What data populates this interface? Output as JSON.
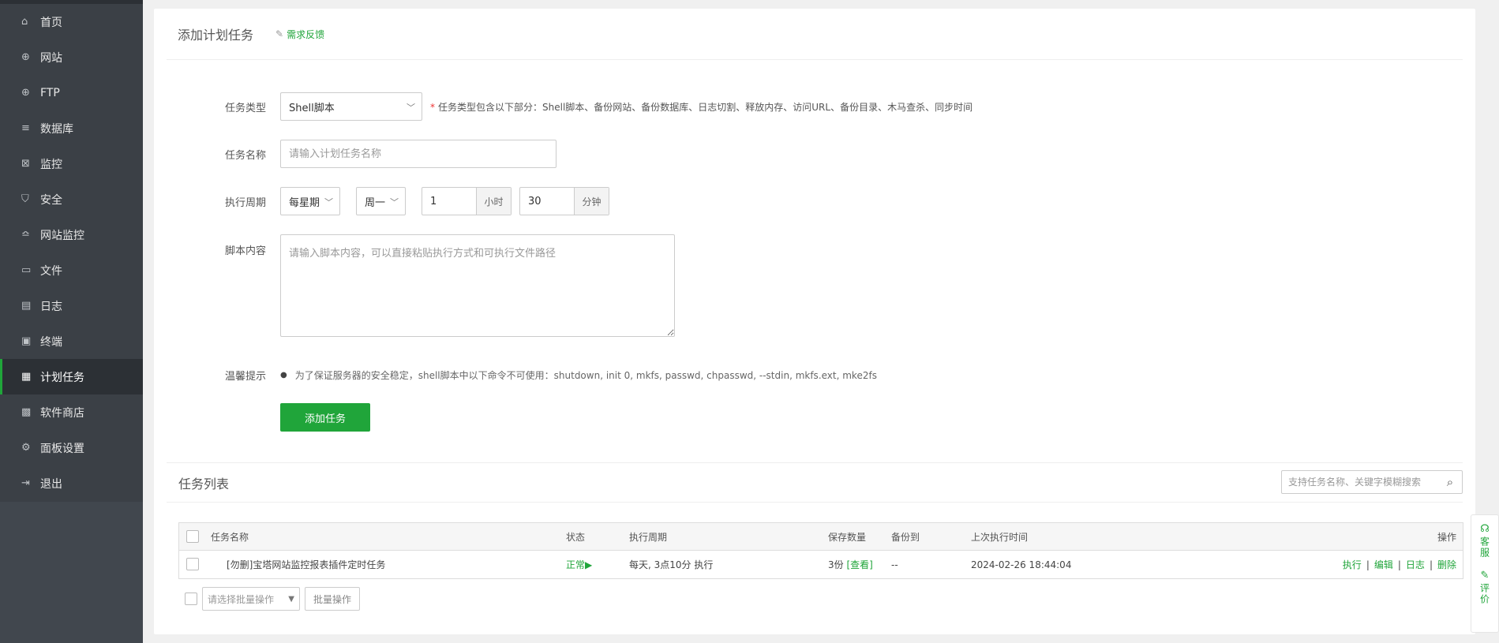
{
  "sidebar": {
    "items": [
      {
        "label": "首页",
        "icon": "home-icon",
        "glyph": "⌂"
      },
      {
        "label": "网站",
        "icon": "globe-icon",
        "glyph": "⊕"
      },
      {
        "label": "FTP",
        "icon": "ftp-icon",
        "glyph": "⊕"
      },
      {
        "label": "数据库",
        "icon": "database-icon",
        "glyph": "≡"
      },
      {
        "label": "监控",
        "icon": "monitor-icon",
        "glyph": "⊠"
      },
      {
        "label": "安全",
        "icon": "shield-icon",
        "glyph": "⛉"
      },
      {
        "label": "网站监控",
        "icon": "site-monitor-icon",
        "glyph": "≏"
      },
      {
        "label": "文件",
        "icon": "folder-icon",
        "glyph": "▭"
      },
      {
        "label": "日志",
        "icon": "log-icon",
        "glyph": "▤"
      },
      {
        "label": "终端",
        "icon": "terminal-icon",
        "glyph": "▣"
      },
      {
        "label": "计划任务",
        "icon": "calendar-icon",
        "glyph": "▦"
      },
      {
        "label": "软件商店",
        "icon": "apps-icon",
        "glyph": "▩"
      },
      {
        "label": "面板设置",
        "icon": "gear-icon",
        "glyph": "⚙"
      },
      {
        "label": "退出",
        "icon": "logout-icon",
        "glyph": "⇥"
      }
    ],
    "active_index": 10
  },
  "add_task": {
    "title": "添加计划任务",
    "feedback": "需求反馈",
    "type_label": "任务类型",
    "type_value": "Shell脚本",
    "type_hint": "任务类型包含以下部分：Shell脚本、备份网站、备份数据库、日志切割、释放内存、访问URL、备份目录、木马查杀、同步时间",
    "name_label": "任务名称",
    "name_placeholder": "请输入计划任务名称",
    "cycle_label": "执行周期",
    "cycle_value": "每星期",
    "weekday_value": "周一",
    "hour_value": "1",
    "hour_unit": "小时",
    "minute_value": "30",
    "minute_unit": "分钟",
    "script_label": "脚本内容",
    "script_placeholder": "请输入脚本内容，可以直接粘贴执行方式和可执行文件路径",
    "tip_label": "温馨提示",
    "tip_text": "为了保证服务器的安全稳定，shell脚本中以下命令不可使用：shutdown, init 0, mkfs, passwd, chpasswd, --stdin, mkfs.ext, mke2fs",
    "submit_label": "添加任务"
  },
  "task_list": {
    "title": "任务列表",
    "search_placeholder": "支持任务名称、关键字模糊搜索",
    "columns": [
      "任务名称",
      "状态",
      "执行周期",
      "保存数量",
      "备份到",
      "上次执行时间",
      "操作"
    ],
    "rows": [
      {
        "name": "[勿删]宝塔网站监控报表插件定时任务",
        "status": "正常▶",
        "cycle": "每天, 3点10分 执行",
        "save_count": "3份",
        "view": "[查看]",
        "backup_to": "--",
        "last_run": "2024-02-26 18:44:04",
        "ops": [
          "执行",
          "编辑",
          "日志",
          "删除"
        ]
      }
    ],
    "batch_placeholder": "请选择批量操作",
    "batch_button": "批量操作"
  },
  "float_widget": {
    "service": "客服",
    "review": "评价"
  },
  "colors": {
    "accent": "#20a53a",
    "sidebar_bg": "#3b4046",
    "sidebar_active": "#2c3035"
  }
}
